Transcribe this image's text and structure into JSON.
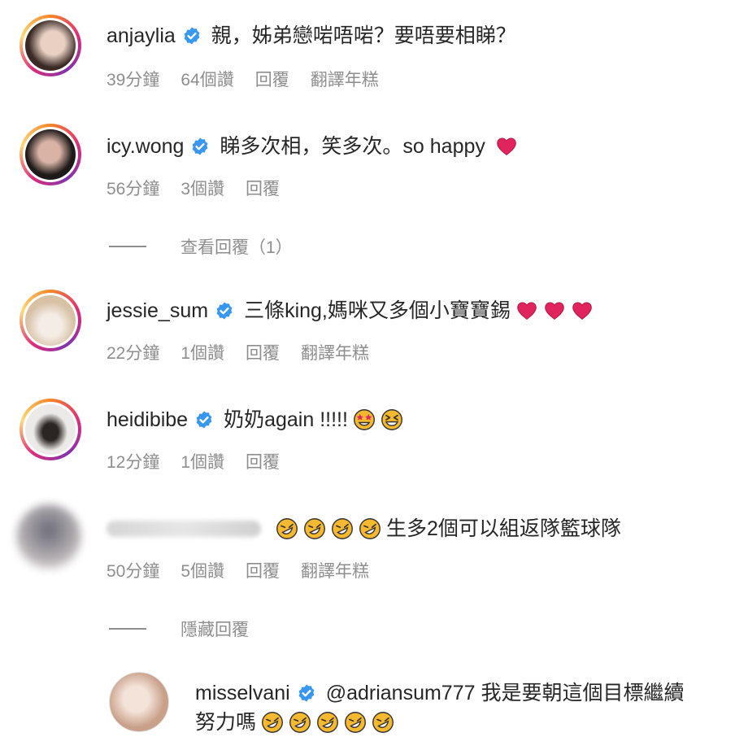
{
  "comments": [
    {
      "username": "anjaylia",
      "text": "親，姊弟戀啱唔啱？要唔要相睇？",
      "time": "39分鐘",
      "likes": "64個讚",
      "reply": "回覆",
      "translate": "翻譯年糕",
      "avatar_colors": [
        "#3a2a26",
        "#e8d0c3"
      ]
    },
    {
      "username": "icy.wong",
      "text": "睇多次相，笑多次。so happy",
      "time": "56分鐘",
      "likes": "3個讚",
      "reply": "回覆",
      "emoji": [
        "red-heart"
      ],
      "view_replies": "查看回覆（1）",
      "avatar_colors": [
        "#1f1a1a",
        "#d9b3a5"
      ]
    },
    {
      "username": "jessie_sum",
      "text": "三條king,媽咪又多個小寶寶錫",
      "time": "22分鐘",
      "likes": "1個讚",
      "reply": "回覆",
      "translate": "翻譯年糕",
      "emoji": [
        "red-heart",
        "red-heart",
        "red-heart"
      ],
      "avatar_colors": [
        "#d8c2a6",
        "#f4ede6"
      ]
    },
    {
      "username": "heidibibe",
      "text": "奶奶again !!!!!",
      "time": "12分鐘",
      "likes": "1個讚",
      "reply": "回覆",
      "emoji": [
        "star-struck",
        "squinting-laugh"
      ],
      "avatar_colors": [
        "#2b2523",
        "#eceae8"
      ]
    },
    {
      "username": "",
      "text": "生多2個可以組返隊籃球隊",
      "time": "50分鐘",
      "likes": "5個讚",
      "reply": "回覆",
      "translate": "翻譯年糕",
      "emoji": [
        "rofl",
        "rofl",
        "rofl",
        "rofl"
      ],
      "hide_replies": "隱藏回覆"
    }
  ],
  "reply": {
    "username": "misselvani",
    "text_line1": "@adriansum777 我是要朝這個目標繼續",
    "text_line2": "努力嗎",
    "emoji": [
      "rofl",
      "rofl",
      "rofl",
      "rofl",
      "rofl"
    ],
    "avatar_colors": [
      "#c9a08a",
      "#f3e3d8"
    ]
  },
  "colors": {
    "text": "#262626",
    "meta": "#8e8e8e",
    "verified": "#3897f0",
    "heart": "#e0245e",
    "emoji": "#f5b82e"
  }
}
